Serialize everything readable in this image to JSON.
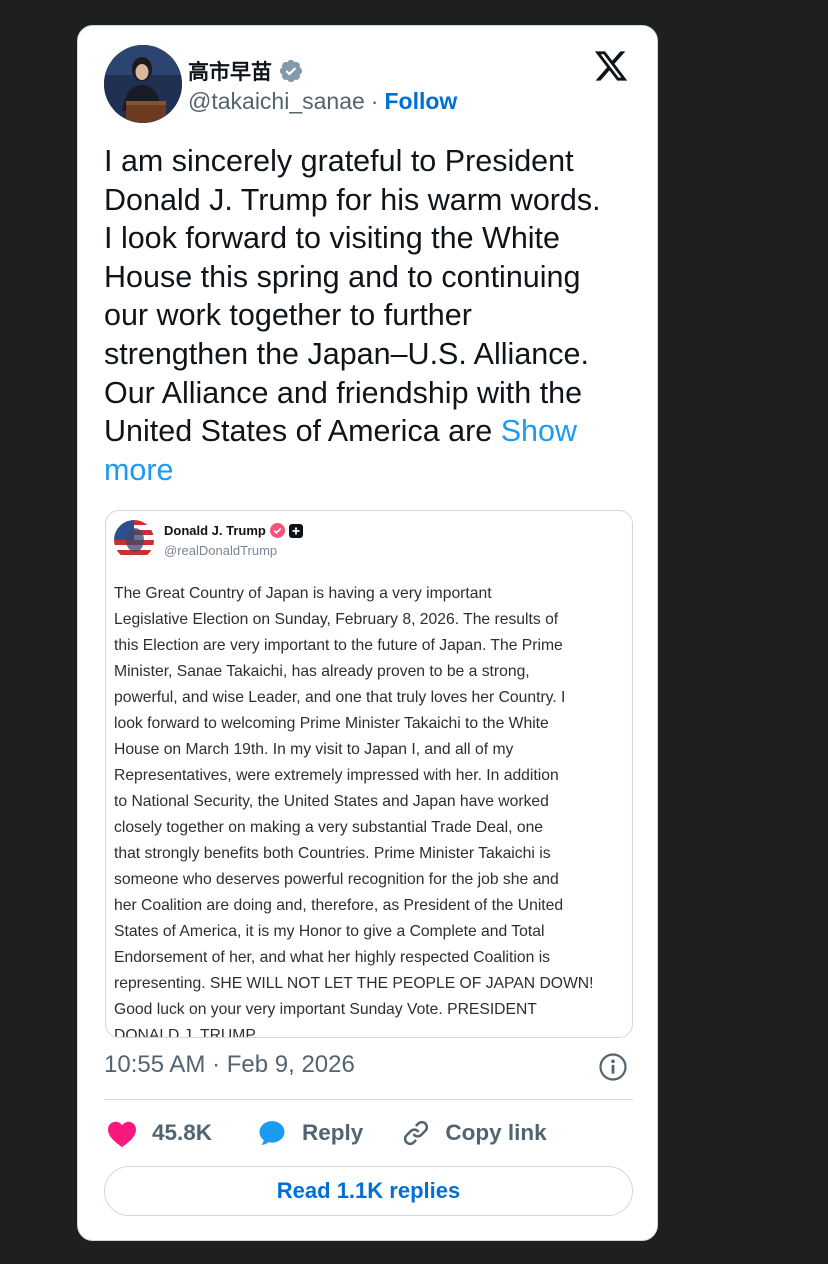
{
  "author": {
    "display_name": "高市早苗",
    "handle": "@takaichi_sanae",
    "separator": "·",
    "follow_label": "Follow"
  },
  "tweet": {
    "lines": [
      "I am sincerely grateful to President",
      "Donald J. Trump for his warm words.",
      "I look forward to visiting the White",
      "House this spring and to continuing",
      "our work together to further",
      "strengthen the Japan–U.S. Alliance.",
      "Our Alliance and friendship with the",
      "United States of America are "
    ],
    "show_more_1": "Show",
    "show_more_2": "more"
  },
  "quote": {
    "name": "Donald J. Trump",
    "handle": "@realDonaldTrump",
    "lines": [
      "The Great Country of Japan is having a very important",
      "Legislative Election on Sunday, February 8, 2026. The results of",
      "this Election are very important to the future of Japan. The Prime",
      "Minister, Sanae Takaichi, has already proven to be a strong,",
      "powerful, and wise Leader, and one that truly loves her Country. I",
      "look forward to welcoming Prime Minister Takaichi to the White",
      "House on March 19th. In my visit to Japan I, and all of my",
      "Representatives, were extremely impressed with her. In addition",
      "to National Security, the United States and Japan have worked",
      "closely together on making a very substantial Trade Deal, one",
      "that strongly benefits both Countries. Prime Minister Takaichi is",
      "someone who deserves powerful recognition for the job she and",
      "her Coalition are doing and, therefore, as President of the United",
      "States of America, it is my Honor to give a Complete and Total",
      "Endorsement of her, and what her highly respected Coalition is",
      "representing. SHE WILL NOT LET THE PEOPLE OF JAPAN DOWN!",
      "Good luck on your very important Sunday Vote. PRESIDENT",
      "DONALD J. TRUMP"
    ]
  },
  "meta": {
    "timestamp": "10:55 AM · Feb 9, 2026"
  },
  "actions": {
    "likes": "45.8K",
    "reply_label": "Reply",
    "copy_link_label": "Copy link",
    "read_replies_label": "Read 1.1K replies"
  },
  "icons": {
    "verified": "verified-badge-icon",
    "x_logo": "x-logo-icon",
    "info": "info-icon",
    "heart": "heart-icon",
    "reply": "reply-bubble-icon",
    "link": "link-icon"
  },
  "colors": {
    "background": "#1e1f21",
    "card": "#ffffff",
    "link_blue": "#1d9bf0",
    "follow_blue": "#006fd6",
    "heart_pink": "#f91880",
    "muted": "#536471"
  }
}
